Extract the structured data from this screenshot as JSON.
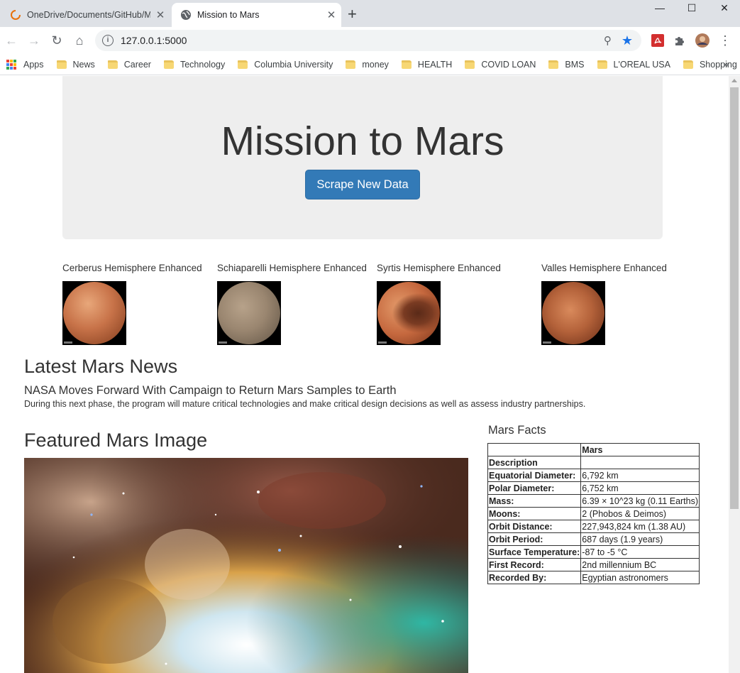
{
  "browser": {
    "tabs": [
      {
        "title": "OneDrive/Documents/GitHub/Mission_to_Mars",
        "active": false
      },
      {
        "title": "Mission to Mars",
        "active": true
      }
    ],
    "url": "127.0.0.1:5000",
    "bookmarks": [
      "Apps",
      "News",
      "Career",
      "Technology",
      "Columbia University",
      "money",
      "HEALTH",
      "COVID LOAN",
      "BMS",
      "L'OREAL USA",
      "Shopping"
    ]
  },
  "header": {
    "title": "Mission to Mars",
    "scrape_button": "Scrape New Data"
  },
  "hemispheres": [
    {
      "title": "Cerberus Hemisphere Enhanced"
    },
    {
      "title": "Schiaparelli Hemisphere Enhanced"
    },
    {
      "title": "Syrtis Hemisphere Enhanced"
    },
    {
      "title": "Valles Hemisphere Enhanced"
    }
  ],
  "news": {
    "heading": "Latest Mars News",
    "title": "NASA Moves Forward With Campaign to Return Mars Samples to Earth",
    "paragraph": "During this next phase, the program will mature critical technologies and make critical design decisions as well as assess industry partnerships."
  },
  "featured": {
    "heading": "Featured Mars Image"
  },
  "facts": {
    "heading": "Mars Facts",
    "column_header": "Mars",
    "rows": [
      {
        "label": "Description",
        "value": ""
      },
      {
        "label": "Equatorial Diameter:",
        "value": "6,792 km"
      },
      {
        "label": "Polar Diameter:",
        "value": "6,752 km"
      },
      {
        "label": "Mass:",
        "value": "6.39 × 10^23 kg (0.11 Earths)"
      },
      {
        "label": "Moons:",
        "value": "2 (Phobos & Deimos)"
      },
      {
        "label": "Orbit Distance:",
        "value": "227,943,824 km (1.38 AU)"
      },
      {
        "label": "Orbit Period:",
        "value": "687 days (1.9 years)"
      },
      {
        "label": "Surface Temperature:",
        "value": "-87 to -5 °C"
      },
      {
        "label": "First Record:",
        "value": "2nd millennium BC"
      },
      {
        "label": "Recorded By:",
        "value": "Egyptian astronomers"
      }
    ]
  }
}
